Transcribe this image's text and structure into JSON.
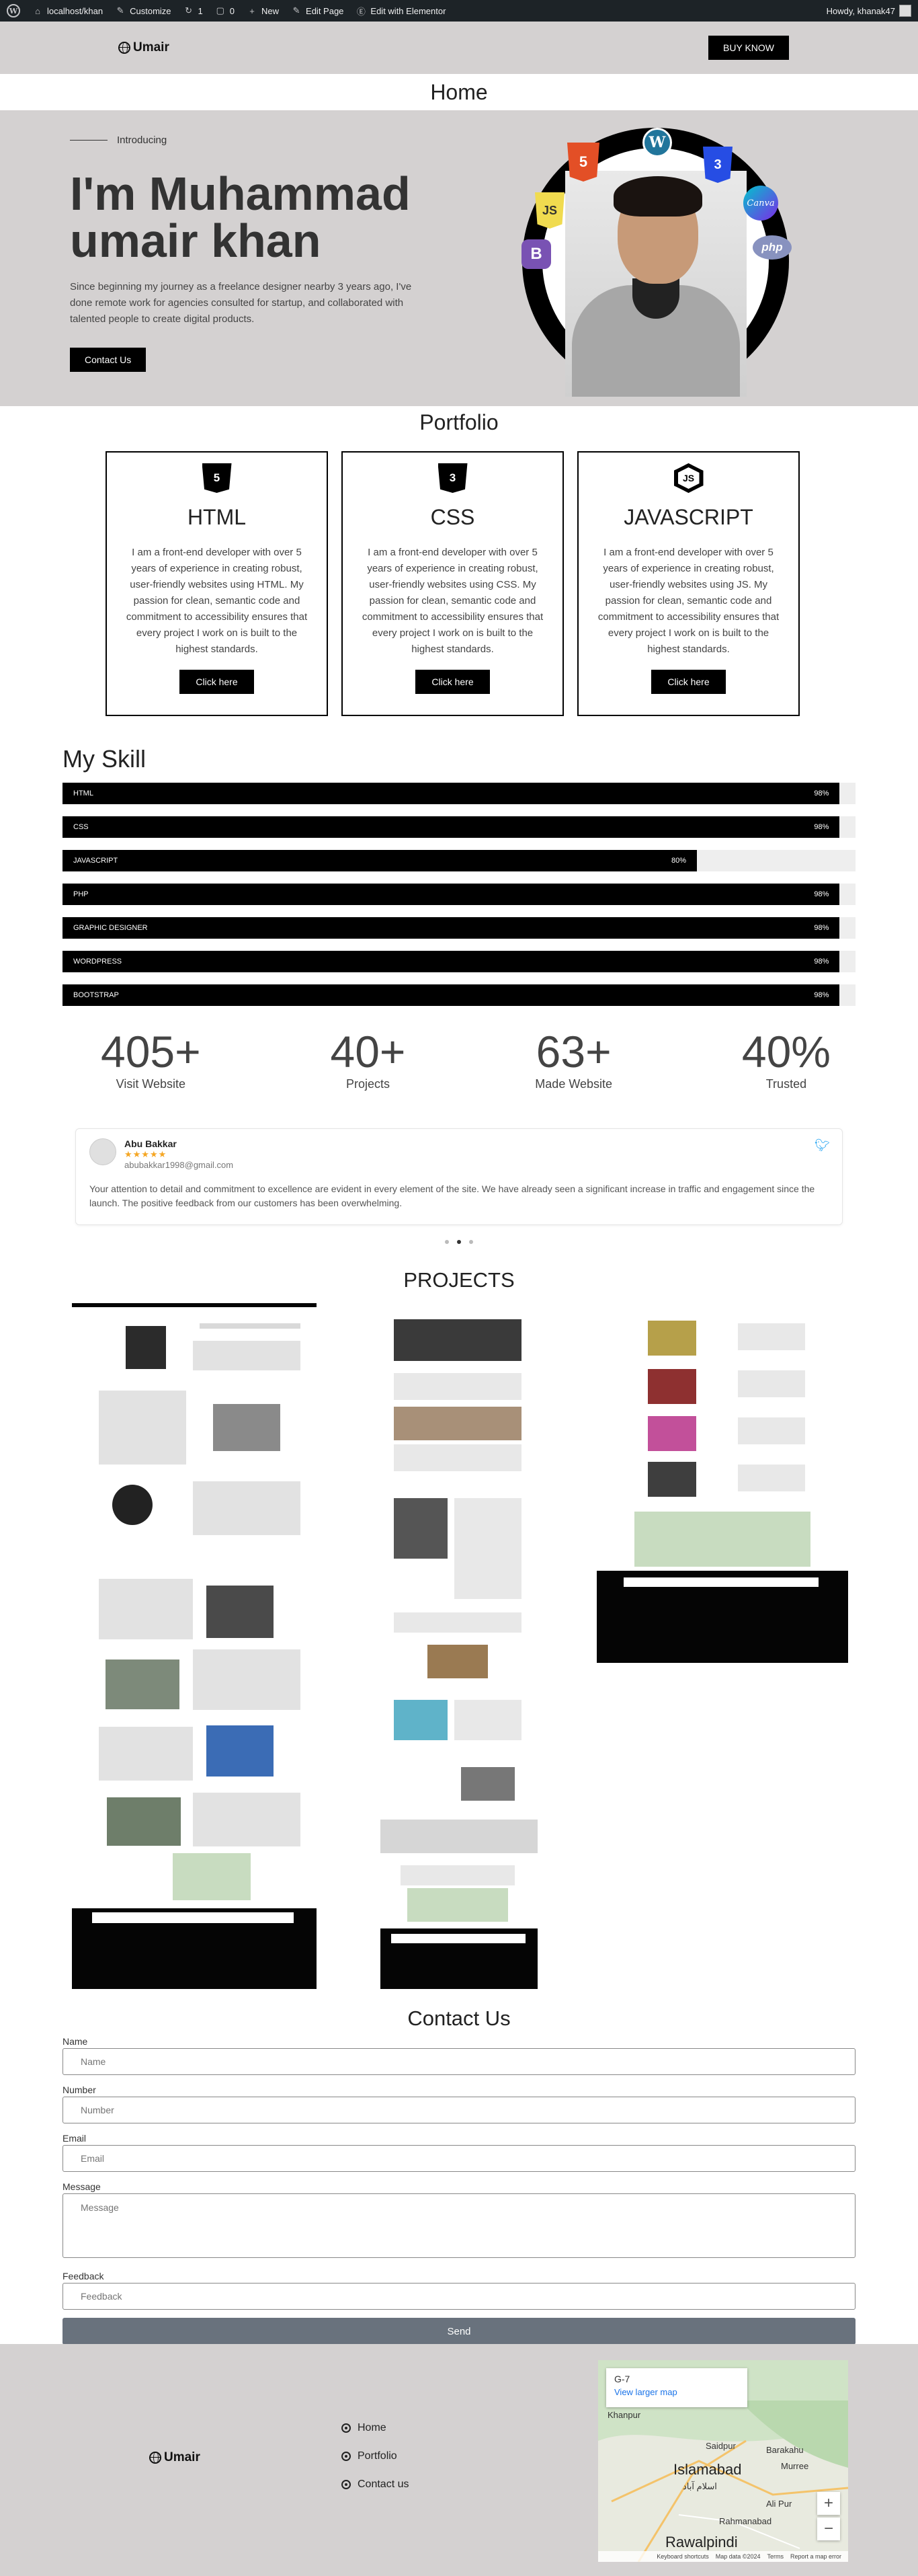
{
  "admin_bar": {
    "site": "localhost/khan",
    "customize": "Customize",
    "updates": "1",
    "comments": "0",
    "new": "New",
    "edit_page": "Edit Page",
    "elementor": "Edit with Elementor",
    "howdy": "Howdy, khanak47"
  },
  "header": {
    "logo": "Umair",
    "cta": "BUY KNOW"
  },
  "page_title": "Home",
  "hero": {
    "intro": "Introducing",
    "heading_line1": "I'm Muhammad",
    "heading_line2": "umair khan",
    "description": "Since beginning my journey as a freelance designer nearby 3 years ago, I've done remote work for agencies consulted for startup, and collaborated with talented people to create digital products.",
    "button": "Contact Us",
    "badges": {
      "html": "5",
      "wordpress": "W",
      "css": "3",
      "js": "JS",
      "canva": "Canva",
      "bootstrap": "B",
      "php": "php"
    }
  },
  "portfolio": {
    "title": "Portfolio",
    "cards": [
      {
        "icon": "5",
        "title": "HTML",
        "text": "I am a front-end developer with over 5 years of experience in creating robust, user-friendly websites using HTML. My passion for clean, semantic code and commitment to accessibility ensures that every project I work on is built to the highest standards.",
        "button": "Click here"
      },
      {
        "icon": "3",
        "title": "CSS",
        "text": "I am a front-end developer with over 5 years of experience in creating robust, user-friendly websites using CSS. My passion for clean, semantic code and commitment to accessibility ensures that every project I work on is built to the highest standards.",
        "button": "Click here"
      },
      {
        "icon": "JS",
        "title": "JAVASCRIPT",
        "text": "I am a front-end developer with over 5 years of experience in creating robust, user-friendly websites using JS. My passion for clean, semantic code and commitment to accessibility ensures that every project I work on is built to the highest standards.",
        "button": "Click here"
      }
    ]
  },
  "skills": {
    "title": "My Skill",
    "items": [
      {
        "label": "HTML",
        "value": 98,
        "display": "98%"
      },
      {
        "label": "CSS",
        "value": 98,
        "display": "98%"
      },
      {
        "label": "JAVASCRIPT",
        "value": 80,
        "display": "80%"
      },
      {
        "label": "PHP",
        "value": 98,
        "display": "98%"
      },
      {
        "label": "GRAPHIC DESIGNER",
        "value": 98,
        "display": "98%"
      },
      {
        "label": "WORDPRESS",
        "value": 98,
        "display": "98%"
      },
      {
        "label": "BOOTSTRAP",
        "value": 98,
        "display": "98%"
      }
    ]
  },
  "counters": [
    {
      "value": "405+",
      "label": "Visit Website"
    },
    {
      "value": "40+",
      "label": "Projects"
    },
    {
      "value": "63+",
      "label": "Made Website"
    },
    {
      "value": "40%",
      "label": "Trusted"
    }
  ],
  "testimonial": {
    "name": "Abu Bakkar",
    "stars": "★★★★★",
    "email": "abubakkar1998@gmail.com",
    "text": "Your attention to detail and commitment to excellence are evident in every element of the site. We have already seen a significant increase in traffic and engagement since the launch. The positive feedback from our customers has been overwhelming.",
    "active_slide": 2,
    "slide_count": 3
  },
  "projects": {
    "title": "PROJECTS"
  },
  "contact": {
    "title": "Contact Us",
    "fields": {
      "name_label": "Name",
      "name_placeholder": "Name",
      "number_label": "Number",
      "number_placeholder": "Number",
      "email_label": "Email",
      "email_placeholder": "Email",
      "message_label": "Message",
      "message_placeholder": "Message",
      "feedback_label": "Feedback",
      "feedback_placeholder": "Feedback"
    },
    "submit": "Send"
  },
  "footer": {
    "logo": "Umair",
    "nav": [
      "Home",
      "Portfolio",
      "Contact us"
    ],
    "map": {
      "place": "G-7",
      "link": "View larger map",
      "labels": [
        "Khanpur",
        "Islamabad",
        "Rawalpindi",
        "Saidpur",
        "Murree",
        "Rahmanabad",
        "Ali Pur",
        "Barakahu",
        "اسلام آباد"
      ],
      "footer_items": [
        "Keyboard shortcuts",
        "Map data ©2024",
        "Terms",
        "Report a map error"
      ]
    }
  },
  "colors": {
    "dark": "#000000",
    "hero_bg": "#d4d1d1",
    "admin_bar": "#1d2327",
    "send_button": "#69727d",
    "star": "#f5a623",
    "twitter": "#1da1f2"
  }
}
